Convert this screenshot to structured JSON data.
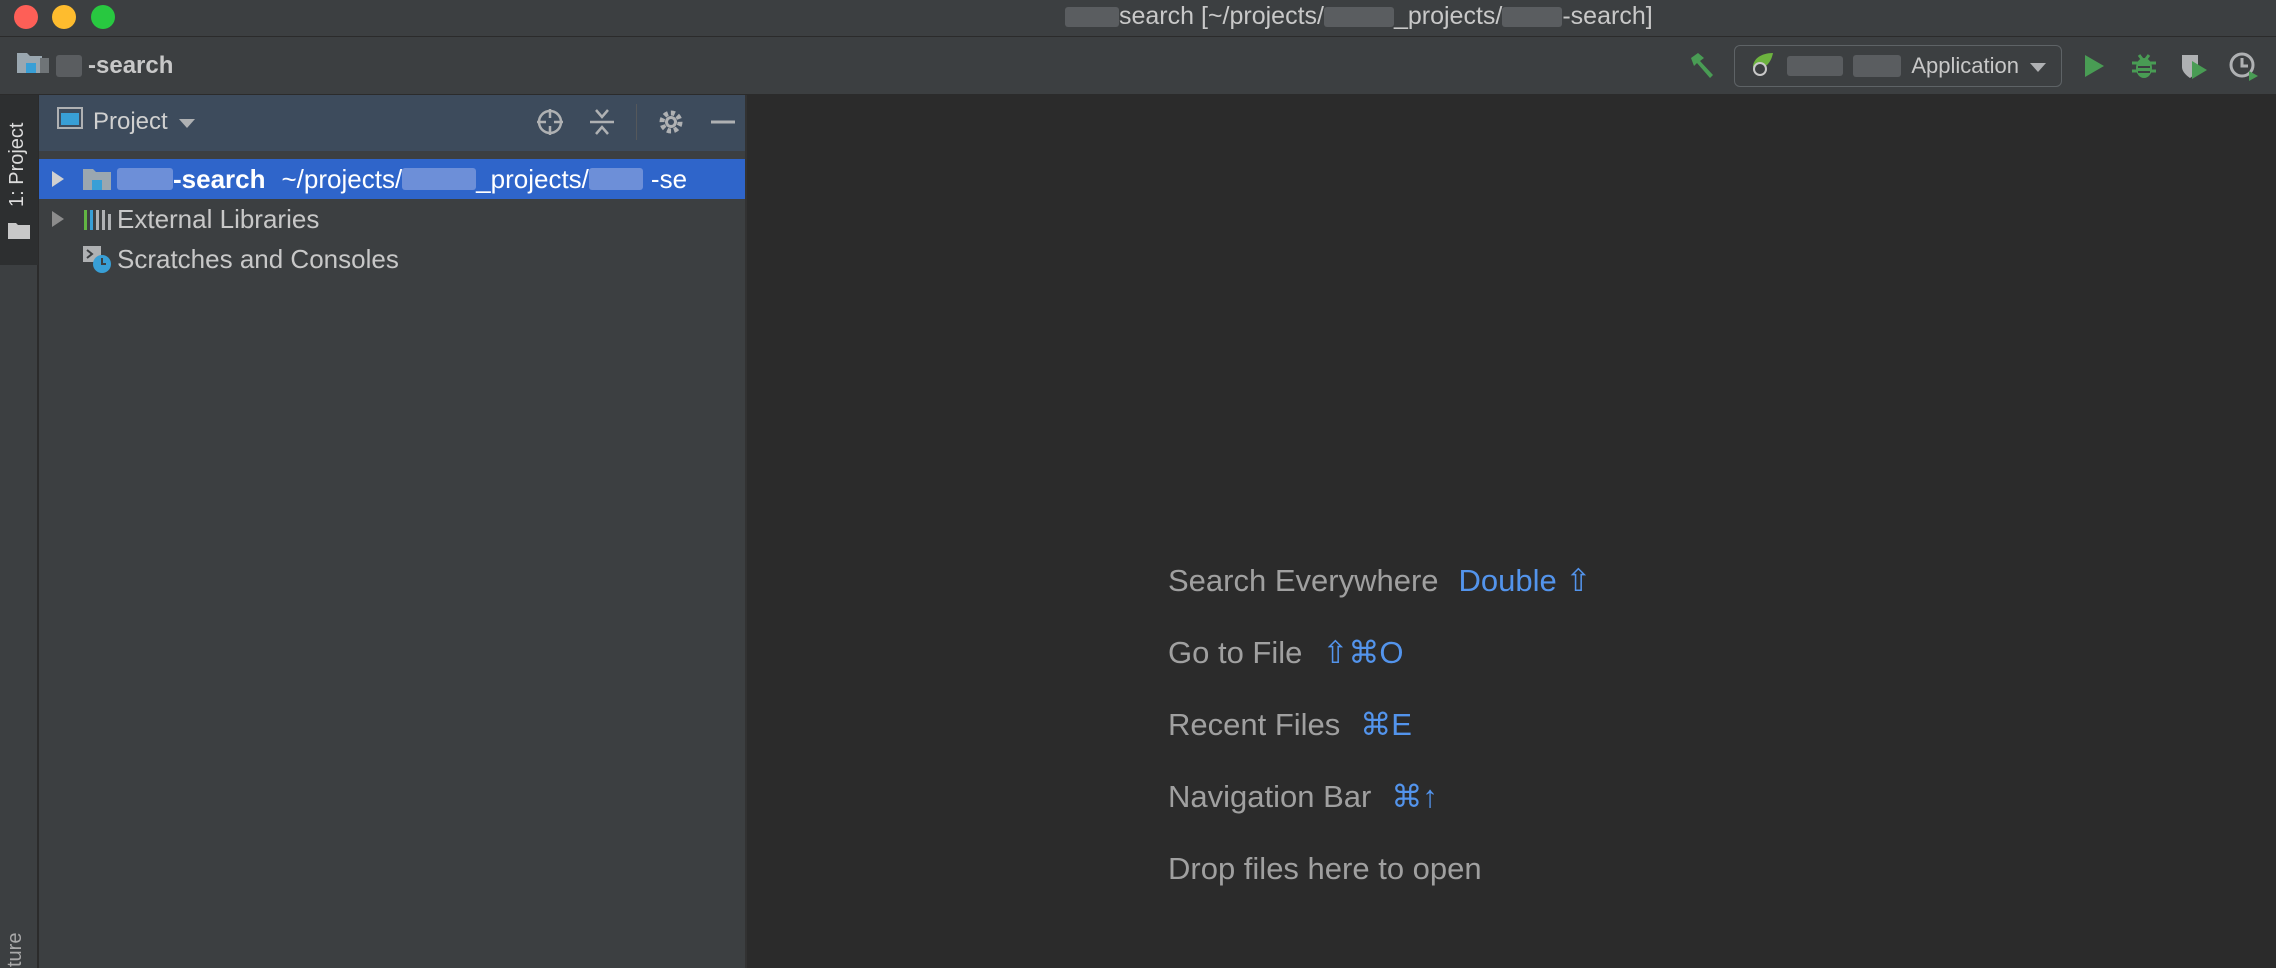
{
  "window": {
    "title_prefix": "",
    "title": "search [~/projects/",
    "title_mid": "_projects/",
    "title_end": "-search]"
  },
  "navbar": {
    "project_name": "-search",
    "run_config_label": "Application"
  },
  "left_stripe": {
    "project_tab": "1: Project",
    "bottom_tab": "ture"
  },
  "project_panel": {
    "view_label": "Project",
    "tree": [
      {
        "name": "-search",
        "path": "~/projects/",
        "path2": "_projects/",
        "path3": "-se"
      },
      {
        "name": "External Libraries"
      },
      {
        "name": "Scratches and Consoles"
      }
    ]
  },
  "editor": {
    "hints": [
      {
        "label": "Search Everywhere",
        "shortcut": "Double ⇧"
      },
      {
        "label": "Go to File",
        "shortcut": "⇧⌘O"
      },
      {
        "label": "Recent Files",
        "shortcut": "⌘E"
      },
      {
        "label": "Navigation Bar",
        "shortcut": "⌘↑"
      },
      {
        "label": "Drop files here to open",
        "shortcut": ""
      }
    ]
  },
  "colors": {
    "selection": "#2f65ca",
    "shortcut": "#5394ec",
    "run_green": "#499c54"
  }
}
